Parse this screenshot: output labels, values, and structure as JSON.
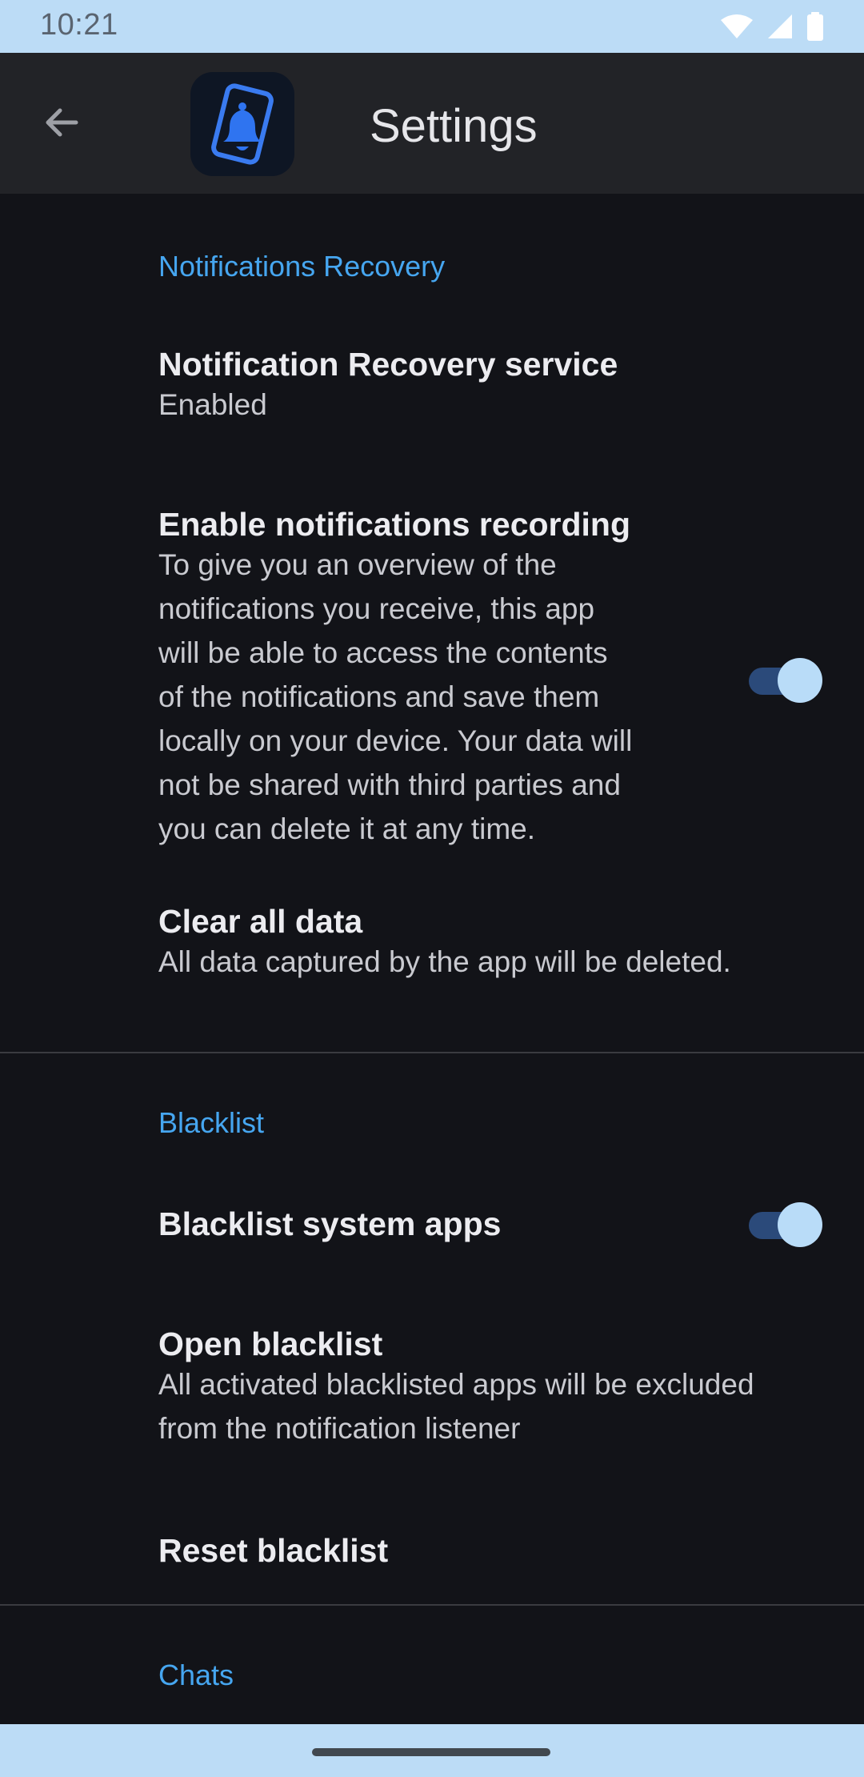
{
  "status_bar": {
    "time": "10:21",
    "icons": [
      "wifi-icon",
      "cell-signal-icon",
      "battery-icon"
    ]
  },
  "app_bar": {
    "title": "Settings",
    "back_icon": "arrow-back-icon",
    "logo_icon": "phone-bell-logo-icon"
  },
  "sections": {
    "recovery": {
      "header": "Notifications Recovery",
      "service": {
        "title": "Notification Recovery service",
        "summary": "Enabled"
      },
      "recording": {
        "title": "Enable notifications recording",
        "summary_lines": [
          "To give you an overview of the",
          "notifications you receive, this app",
          "will be able to access the contents",
          "of the notifications and save them",
          "locally on your device. Your data will",
          "not be shared with third parties and",
          "you can delete it at any time."
        ],
        "enabled": true
      },
      "clear": {
        "title": "Clear all data",
        "summary": "All data captured by the app will be deleted."
      }
    },
    "blacklist": {
      "header": "Blacklist",
      "system_apps": {
        "title": "Blacklist system apps",
        "enabled": true
      },
      "open": {
        "title": "Open blacklist",
        "summary_lines": [
          "All activated blacklisted apps will be excluded",
          "from the notification listener"
        ]
      },
      "reset": {
        "title": "Reset blacklist"
      }
    },
    "chats": {
      "header": "Chats"
    }
  },
  "colors": {
    "background": "#121318",
    "app_bar": "#222327",
    "accent": "#46a6f0",
    "switch_track": "#2b4a7a",
    "switch_thumb": "#b9dcf8",
    "system_bars": "#bcdcf6"
  }
}
